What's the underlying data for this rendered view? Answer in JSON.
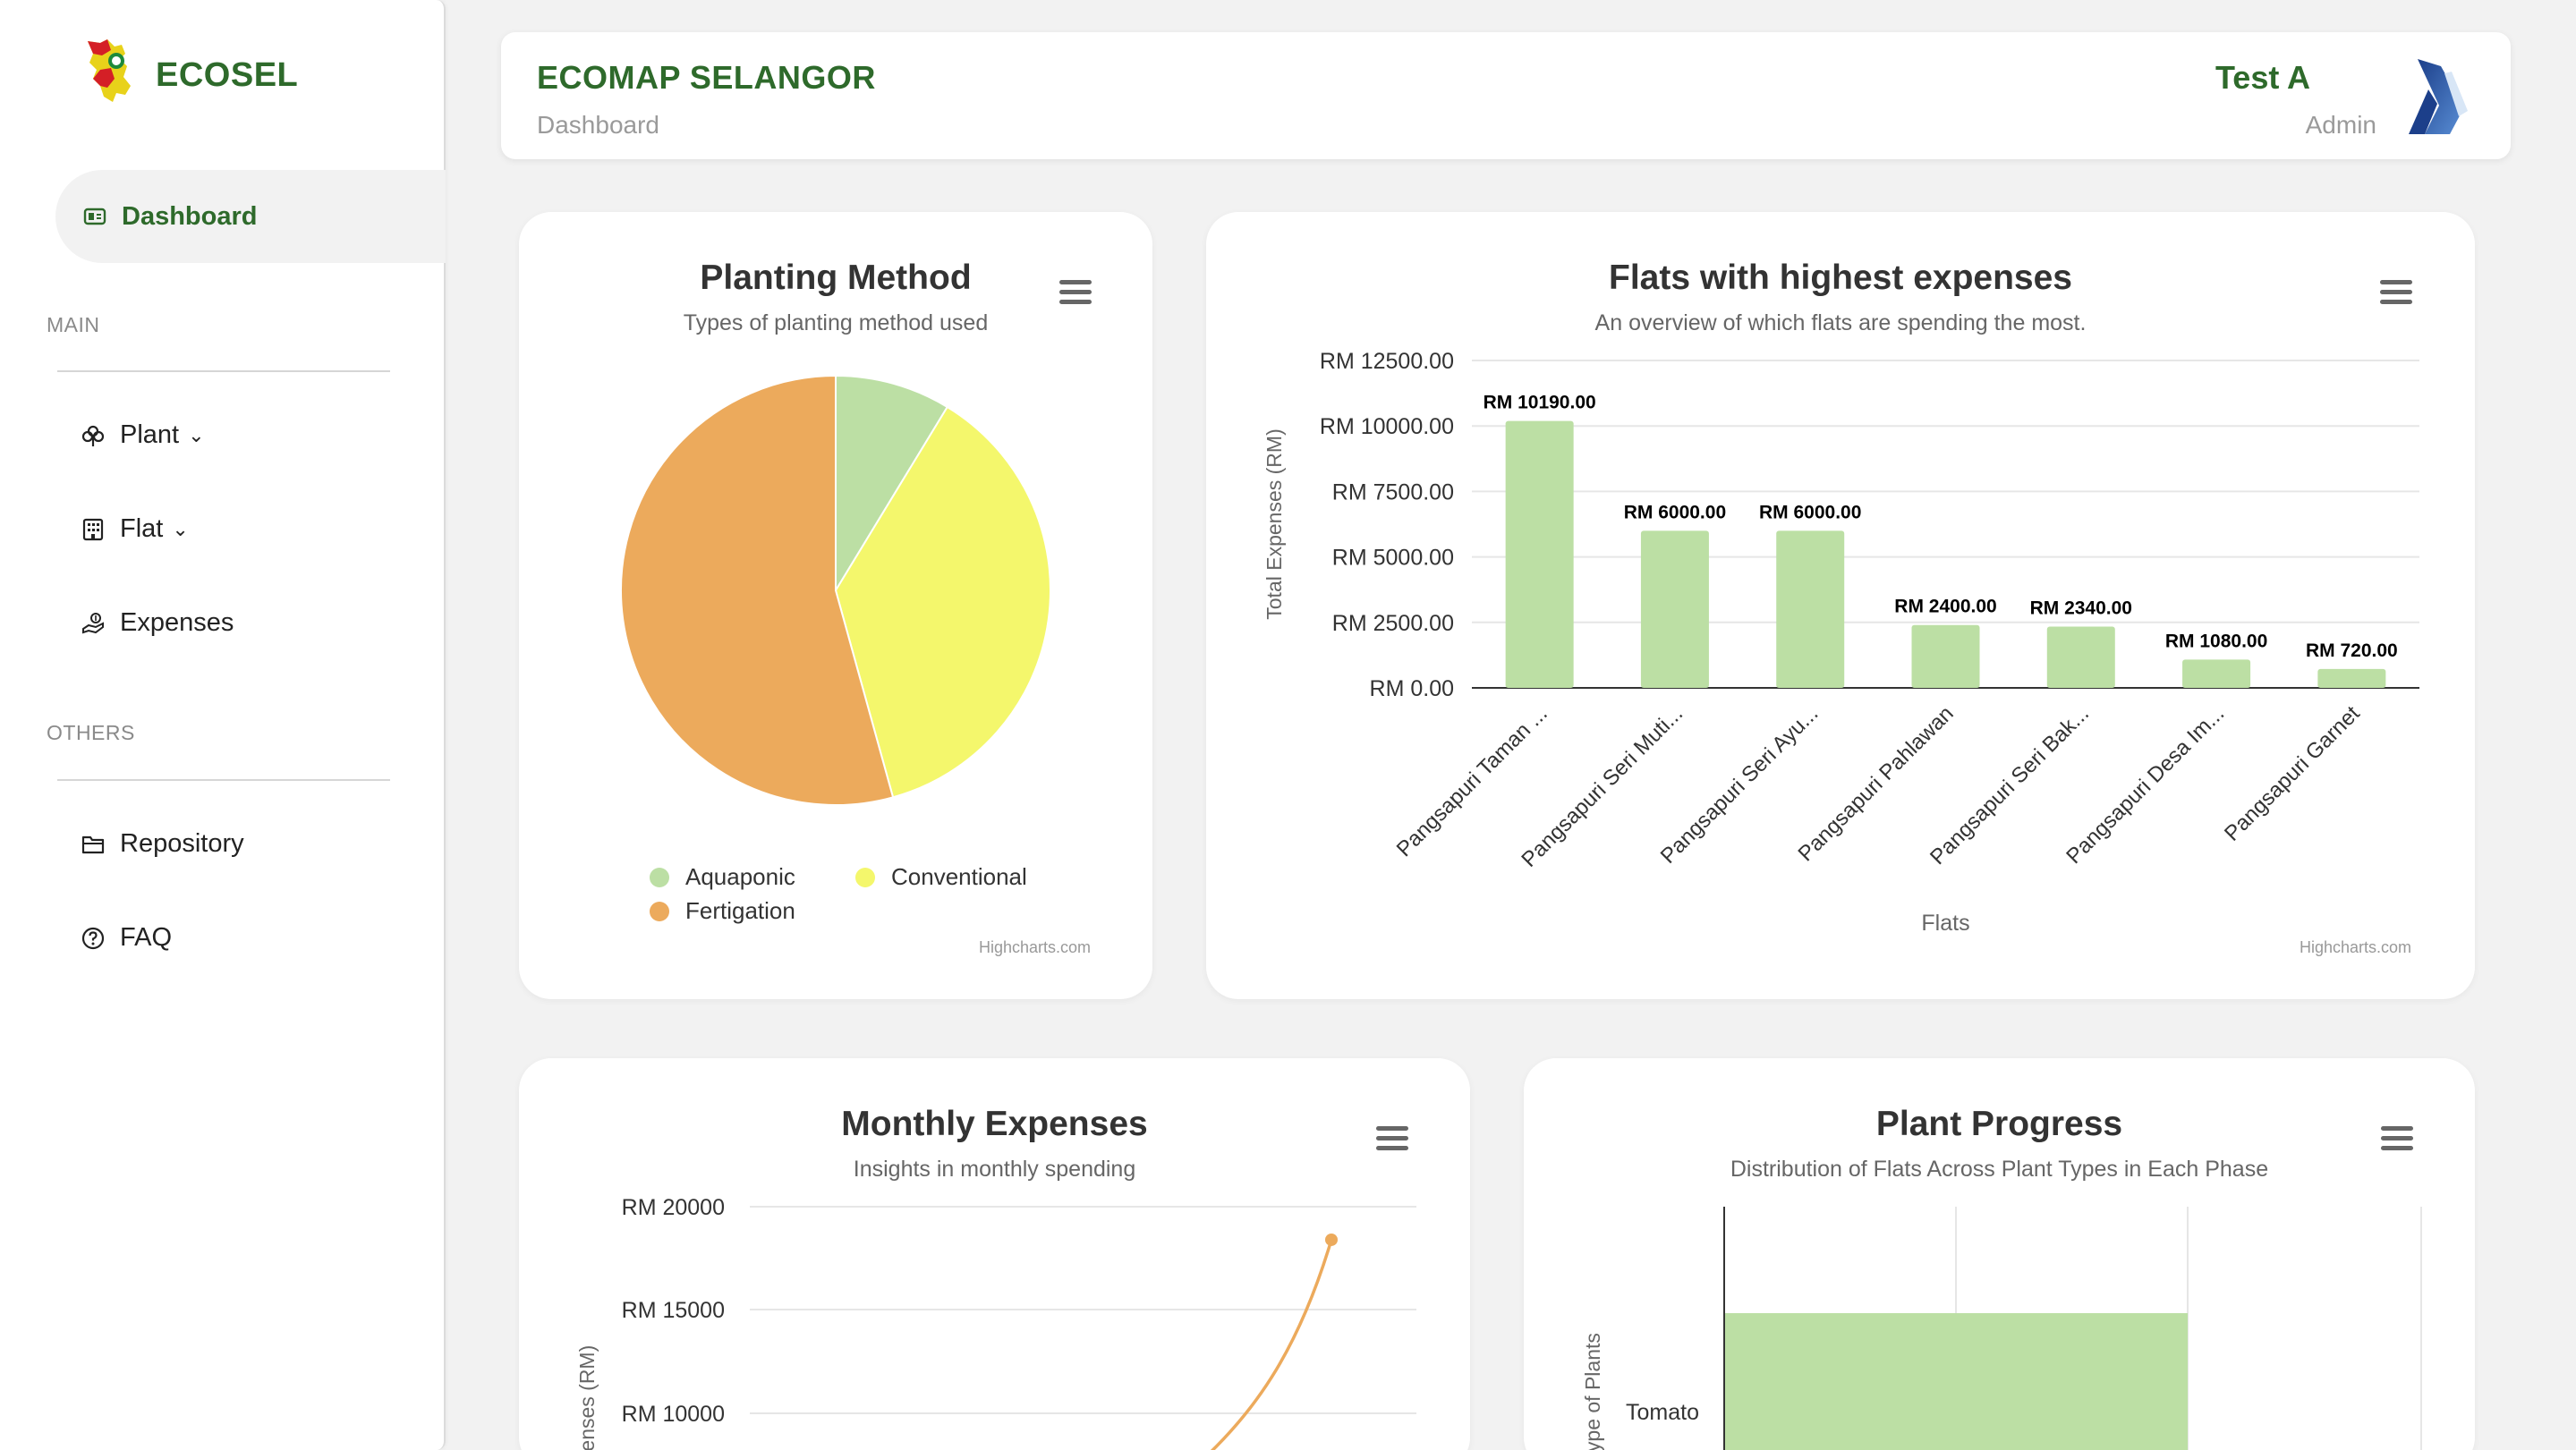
{
  "sidebar": {
    "brand": "ECOSEL",
    "active_item": "Dashboard",
    "section_main": "MAIN",
    "section_others": "OTHERS",
    "items": [
      {
        "label": "Plant",
        "has_dropdown": true,
        "icon": "plant-icon"
      },
      {
        "label": "Flat",
        "has_dropdown": true,
        "icon": "building-icon"
      },
      {
        "label": "Expenses",
        "has_dropdown": false,
        "icon": "money-hand-icon"
      },
      {
        "label": "Repository",
        "has_dropdown": false,
        "icon": "folder-icon"
      },
      {
        "label": "FAQ",
        "has_dropdown": false,
        "icon": "question-icon"
      }
    ]
  },
  "header": {
    "title": "ECOMAP SELANGOR",
    "breadcrumb": "Dashboard",
    "user_name": "Test A",
    "user_role": "Admin"
  },
  "colors": {
    "brand_green": "#2e6a2b",
    "aquaponic": "#bcdfa4",
    "conventional": "#f4f76c",
    "fertigation": "#ecaa5c"
  },
  "credit": "Highcharts.com",
  "chart_data": [
    {
      "type": "pie",
      "title": "Planting Method",
      "subtitle": "Types of planting method used",
      "legend_position": "bottom",
      "slices": [
        {
          "name": "Aquaponic",
          "value": 8.7,
          "color": "#bcdfa4"
        },
        {
          "name": "Conventional",
          "value": 37.0,
          "color": "#f4f76c"
        },
        {
          "name": "Fertigation",
          "value": 54.3,
          "color": "#ecaa5c"
        }
      ]
    },
    {
      "type": "bar",
      "title": "Flats with highest expenses",
      "subtitle": "An overview of which flats are spending the most.",
      "xlabel": "Flats",
      "ylabel": "Total Expenses (RM)",
      "ylim": [
        0,
        12500
      ],
      "yticks": [
        "RM 0.00",
        "RM 2500.00",
        "RM 5000.00",
        "RM 7500.00",
        "RM 10000.00",
        "RM 12500.00"
      ],
      "categories": [
        "Pangsapuri Taman ...",
        "Pangsapuri Seri Muti...",
        "Pangsapuri Seri Ayu...",
        "Pangsapuri Pahlawan",
        "Pangsapuri Seri Bak...",
        "Pangsapuri Desa Im...",
        "Pangsapuri Garnet"
      ],
      "values": [
        10190,
        6000,
        6000,
        2400,
        2340,
        1080,
        720
      ],
      "data_labels": [
        "RM 10190.00",
        "RM 6000.00",
        "RM 6000.00",
        "RM 2400.00",
        "RM 2340.00",
        "RM 1080.00",
        "RM 720.00"
      ],
      "color": "#bcdfa4",
      "grid": true
    },
    {
      "type": "line",
      "title": "Monthly Expenses",
      "subtitle": "Insights in monthly spending",
      "ylabel": "Expenses (RM)",
      "yticks": [
        "RM 10000",
        "RM 15000",
        "RM 20000"
      ],
      "visible_points": [
        18400
      ],
      "color": "#ecaa5c",
      "grid": true
    },
    {
      "type": "bar",
      "orientation": "horizontal",
      "title": "Plant Progress",
      "subtitle": "Distribution of Flats Across Plant Types in Each Phase",
      "ylabel": "Type of Plants",
      "categories": [
        "Tomato"
      ],
      "color": "#bcdfa4",
      "grid": true
    }
  ]
}
